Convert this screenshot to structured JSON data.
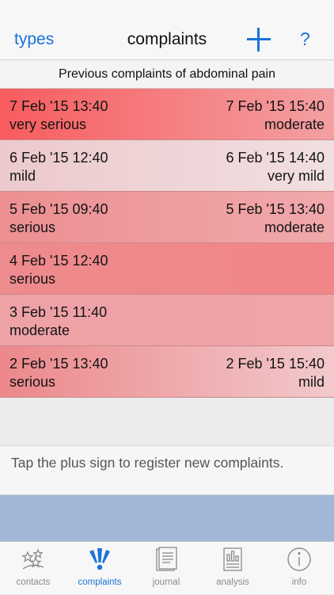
{
  "nav": {
    "left_label": "types",
    "title": "complaints",
    "help_label": "?"
  },
  "subheader": "Previous complaints of abdominal pain",
  "complaints": [
    {
      "start": "7 Feb '15 13:40",
      "start_level": "very serious",
      "end": "7 Feb '15 15:40",
      "end_level": "moderate",
      "color_start": "#f85c5e",
      "color_end": "#f3a0a3"
    },
    {
      "start": "6 Feb '15 12:40",
      "start_level": "mild",
      "end": "6 Feb '15 14:40",
      "end_level": "very mild",
      "color_start": "#ecc9cc",
      "color_end": "#f1dfe1"
    },
    {
      "start": "5 Feb '15 09:40",
      "start_level": "serious",
      "end": "5 Feb '15 13:40",
      "end_level": "moderate",
      "color_start": "#ec8f92",
      "color_end": "#f0a9ac"
    },
    {
      "start": "4 Feb '15 12:40",
      "start_level": "serious",
      "end": "",
      "end_level": "",
      "color_start": "#ee8b8e",
      "color_end": "#f18587"
    },
    {
      "start": "3 Feb '15 11:40",
      "start_level": "moderate",
      "end": "",
      "end_level": "",
      "color_start": "#eea2a6",
      "color_end": "#f1a4a8"
    },
    {
      "start": "2 Feb '15 13:40",
      "start_level": "serious",
      "end": "2 Feb '15 15:40",
      "end_level": "mild",
      "color_start": "#ec888b",
      "color_end": "#f2c9cc"
    }
  ],
  "hint": "Tap the plus sign to register new complaints.",
  "tabs": [
    {
      "label": "contacts",
      "icon": "contacts-icon",
      "active": false
    },
    {
      "label": "complaints",
      "icon": "complaints-icon",
      "active": true
    },
    {
      "label": "journal",
      "icon": "journal-icon",
      "active": false
    },
    {
      "label": "analysis",
      "icon": "analysis-icon",
      "active": false
    },
    {
      "label": "info",
      "icon": "info-icon",
      "active": false
    }
  ],
  "colors": {
    "accent": "#1a73d9",
    "tab_inactive": "#8a8a8a",
    "band": "#a2b6d6"
  }
}
